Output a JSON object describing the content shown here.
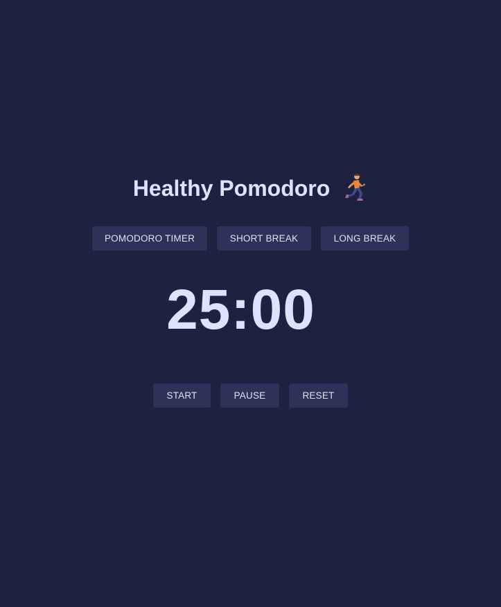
{
  "app": {
    "title": "Healthy Pomodoro",
    "title_icon": "running-person-icon"
  },
  "modes": {
    "pomodoro_label": "POMODORO TIMER",
    "short_break_label": "SHORT BREAK",
    "long_break_label": "LONG BREAK"
  },
  "timer": {
    "display": "25:00"
  },
  "controls": {
    "start_label": "START",
    "pause_label": "PAUSE",
    "reset_label": "RESET"
  },
  "colors": {
    "background": "#1f2140",
    "button": "#2f3158",
    "text": "#dde2ff",
    "runner_skin": "#e8a87c",
    "runner_shirt": "#e8883a",
    "runner_pants": "#3a4a8a"
  }
}
